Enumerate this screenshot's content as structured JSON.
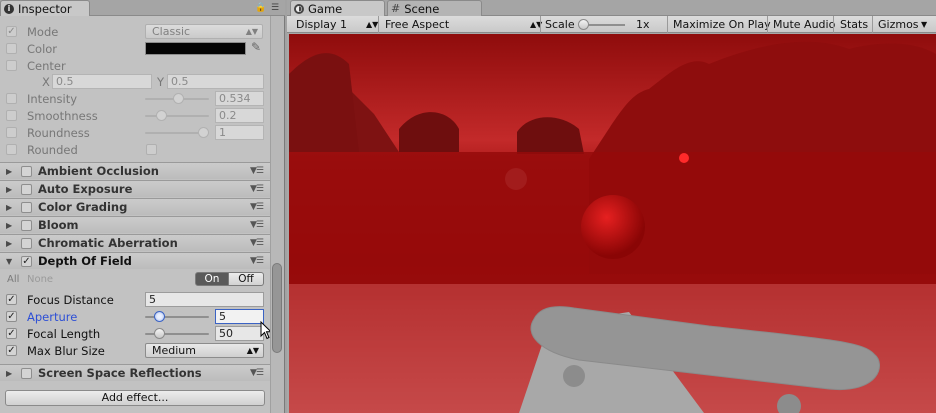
{
  "inspector": {
    "tab_label": "Inspector",
    "mode": {
      "label": "Mode",
      "value": "Classic"
    },
    "color": {
      "label": "Color"
    },
    "center": {
      "label": "Center",
      "x_label": "X",
      "x_value": "0.5",
      "y_label": "Y",
      "y_value": "0.5"
    },
    "intensity": {
      "label": "Intensity",
      "value": "0.534",
      "level": 0.534
    },
    "smoothness": {
      "label": "Smoothness",
      "value": "0.2",
      "level": 0.2
    },
    "roundness": {
      "label": "Roundness",
      "value": "1",
      "level": 1
    },
    "rounded": {
      "label": "Rounded"
    },
    "sections": [
      {
        "title": "Ambient Occlusion",
        "enabled": false
      },
      {
        "title": "Auto Exposure",
        "enabled": false
      },
      {
        "title": "Color Grading",
        "enabled": false
      },
      {
        "title": "Bloom",
        "enabled": false
      },
      {
        "title": "Chromatic Aberration",
        "enabled": false
      }
    ],
    "dof": {
      "title": "Depth Of Field",
      "enabled": true,
      "all_label": "All",
      "none_label": "None",
      "on_label": "On",
      "off_label": "Off",
      "focus_distance": {
        "label": "Focus Distance",
        "value": "5"
      },
      "aperture": {
        "label": "Aperture",
        "value": "5",
        "level": 0.17
      },
      "focal_length": {
        "label": "Focal Length",
        "value": "50",
        "level": 0.17
      },
      "max_blur": {
        "label": "Max Blur Size",
        "value": "Medium"
      }
    },
    "ssr_section": {
      "title": "Screen Space Reflections",
      "enabled": false
    },
    "add_effect": "Add effect..."
  },
  "game": {
    "tabs": [
      {
        "label": "Game",
        "active": true
      },
      {
        "label": "Scene",
        "active": false
      }
    ],
    "toolbar": {
      "display": "Display 1",
      "aspect": "Free Aspect",
      "scale_label": "Scale",
      "scale_value": "1x",
      "maximize": "Maximize On Play",
      "mute": "Mute Audio",
      "stats": "Stats",
      "gizmos": "Gizmos"
    }
  },
  "colors": {
    "accent_blue": "#3b63c4",
    "game_tint": "#b01010"
  }
}
